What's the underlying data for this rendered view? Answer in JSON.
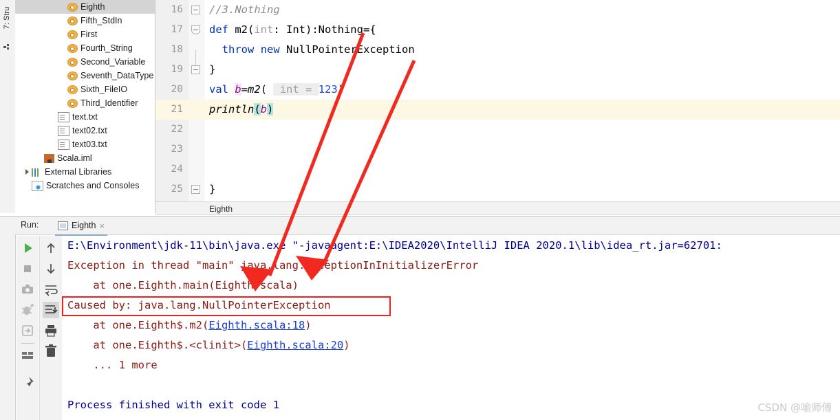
{
  "left_strip": {
    "label": "7: Stru",
    "icon": "structure-icon"
  },
  "project_tree": {
    "items": [
      {
        "label": "Eighth",
        "icon": "scala-object-icon",
        "indent": 78,
        "selected": true,
        "arrow": false
      },
      {
        "label": "Fifth_StdIn",
        "icon": "scala-object-icon",
        "indent": 78,
        "selected": false,
        "arrow": false
      },
      {
        "label": "First",
        "icon": "scala-object-icon",
        "indent": 78,
        "selected": false,
        "arrow": false
      },
      {
        "label": "Fourth_String",
        "icon": "scala-object-icon",
        "indent": 78,
        "selected": false,
        "arrow": false
      },
      {
        "label": "Second_Variable",
        "icon": "scala-object-icon",
        "indent": 78,
        "selected": false,
        "arrow": false
      },
      {
        "label": "Seventh_DataType",
        "icon": "scala-object-icon",
        "indent": 78,
        "selected": false,
        "arrow": false
      },
      {
        "label": "Sixth_FileIO",
        "icon": "scala-object-icon",
        "indent": 78,
        "selected": false,
        "arrow": false
      },
      {
        "label": "Third_Identifier",
        "icon": "scala-object-icon",
        "indent": 78,
        "selected": false,
        "arrow": false
      },
      {
        "label": "text.txt",
        "icon": "text-file-icon",
        "indent": 62,
        "selected": false,
        "arrow": false
      },
      {
        "label": "text02.txt",
        "icon": "text-file-icon",
        "indent": 62,
        "selected": false,
        "arrow": false
      },
      {
        "label": "text03.txt",
        "icon": "text-file-icon",
        "indent": 62,
        "selected": false,
        "arrow": false
      },
      {
        "label": "Scala.iml",
        "icon": "iml-file-icon",
        "indent": 44,
        "selected": false,
        "arrow": false
      },
      {
        "label": "External Libraries",
        "icon": "libraries-icon",
        "indent": 26,
        "selected": false,
        "arrow": true
      },
      {
        "label": "Scratches and Consoles",
        "icon": "scratches-icon",
        "indent": 26,
        "selected": false,
        "arrow": false
      }
    ]
  },
  "editor": {
    "current_line": 21,
    "lines": [
      {
        "number": "16",
        "fold": "minus",
        "text": "//3.Nothing"
      },
      {
        "number": "17",
        "fold": "down",
        "text": "def m2(int: Int):Nothing={"
      },
      {
        "number": "18",
        "fold": "none",
        "text": "  throw new NullPointerException"
      },
      {
        "number": "19",
        "fold": "minus",
        "text": "}"
      },
      {
        "number": "20",
        "fold": "none",
        "text": "val b=m2( int = 123)"
      },
      {
        "number": "21",
        "fold": "none",
        "text": "println(b)"
      },
      {
        "number": "22",
        "fold": "none",
        "text": ""
      },
      {
        "number": "23",
        "fold": "none",
        "text": ""
      },
      {
        "number": "24",
        "fold": "none",
        "text": ""
      },
      {
        "number": "25",
        "fold": "minus",
        "text": "}"
      }
    ],
    "tokens": {
      "comment": "//3.Nothing",
      "kw_def": "def",
      "fn_m2": "m2",
      "param_int": "int",
      "type_int": "Int",
      "type_nothing": "Nothing",
      "kw_throw": "throw",
      "kw_new": "new",
      "npe": "NullPointerException",
      "kw_val": "val",
      "var_b": "b",
      "hint_int": " int = ",
      "literal_123": "123",
      "fn_println": "println"
    }
  },
  "breadcrumb": {
    "text": "Eighth"
  },
  "run_panel": {
    "run_label": "Run:",
    "tab_label": "Eighth",
    "tab_close": "×",
    "toolbar_left": [
      {
        "name": "rerun-button",
        "icon": "play-icon"
      },
      {
        "name": "stop-button",
        "icon": "stop-icon"
      },
      {
        "name": "screenshot-button",
        "icon": "camera-icon"
      },
      {
        "name": "debug-button",
        "icon": "bug-icon"
      },
      {
        "name": "export-button",
        "icon": "export-icon"
      },
      {
        "name": "layout-button",
        "icon": "layout-icon"
      },
      {
        "name": "pin-button",
        "icon": "pin-icon"
      }
    ],
    "toolbar_right": [
      {
        "name": "up-button",
        "icon": "arrow-up-icon",
        "active": false
      },
      {
        "name": "down-button",
        "icon": "arrow-down-icon",
        "active": false
      },
      {
        "name": "soft-wrap-button",
        "icon": "soft-wrap-icon",
        "active": false
      },
      {
        "name": "scroll-to-end-button",
        "icon": "scroll-end-icon",
        "active": true
      },
      {
        "name": "print-button",
        "icon": "printer-icon",
        "active": false
      },
      {
        "name": "clear-all-button",
        "icon": "trash-icon",
        "active": false
      }
    ],
    "console": {
      "lines": [
        {
          "kind": "cmd",
          "text": "E:\\Environment\\jdk-11\\bin\\java.exe \"-javaagent:E:\\IDEA2020\\IntelliJ IDEA 2020.1\\lib\\idea_rt.jar=62701:"
        },
        {
          "kind": "err",
          "text": "Exception in thread \"main\" java.lang.ExceptionInInitializerError"
        },
        {
          "kind": "err",
          "text": "    at one.Eighth.main(Eighth.scala)"
        },
        {
          "kind": "err",
          "text": "Caused by: java.lang.NullPointerException"
        },
        {
          "kind": "link",
          "pre": "    at one.Eighth$.m2(",
          "link": "Eighth.scala:18",
          "post": ")"
        },
        {
          "kind": "link",
          "pre": "    at one.Eighth$.<clinit>(",
          "link": "Eighth.scala:20",
          "post": ")"
        },
        {
          "kind": "err",
          "text": "    ... 1 more"
        },
        {
          "kind": "blank",
          "text": ""
        },
        {
          "kind": "cmd",
          "text": "Process finished with exit code 1"
        }
      ]
    }
  },
  "annotations": {
    "highlight_box_label": "caused-by-highlight",
    "arrows": 2,
    "arrow_color": "#f02a20",
    "box_color": "#f02020"
  },
  "watermark": {
    "text": "CSDN @喻师傅"
  }
}
